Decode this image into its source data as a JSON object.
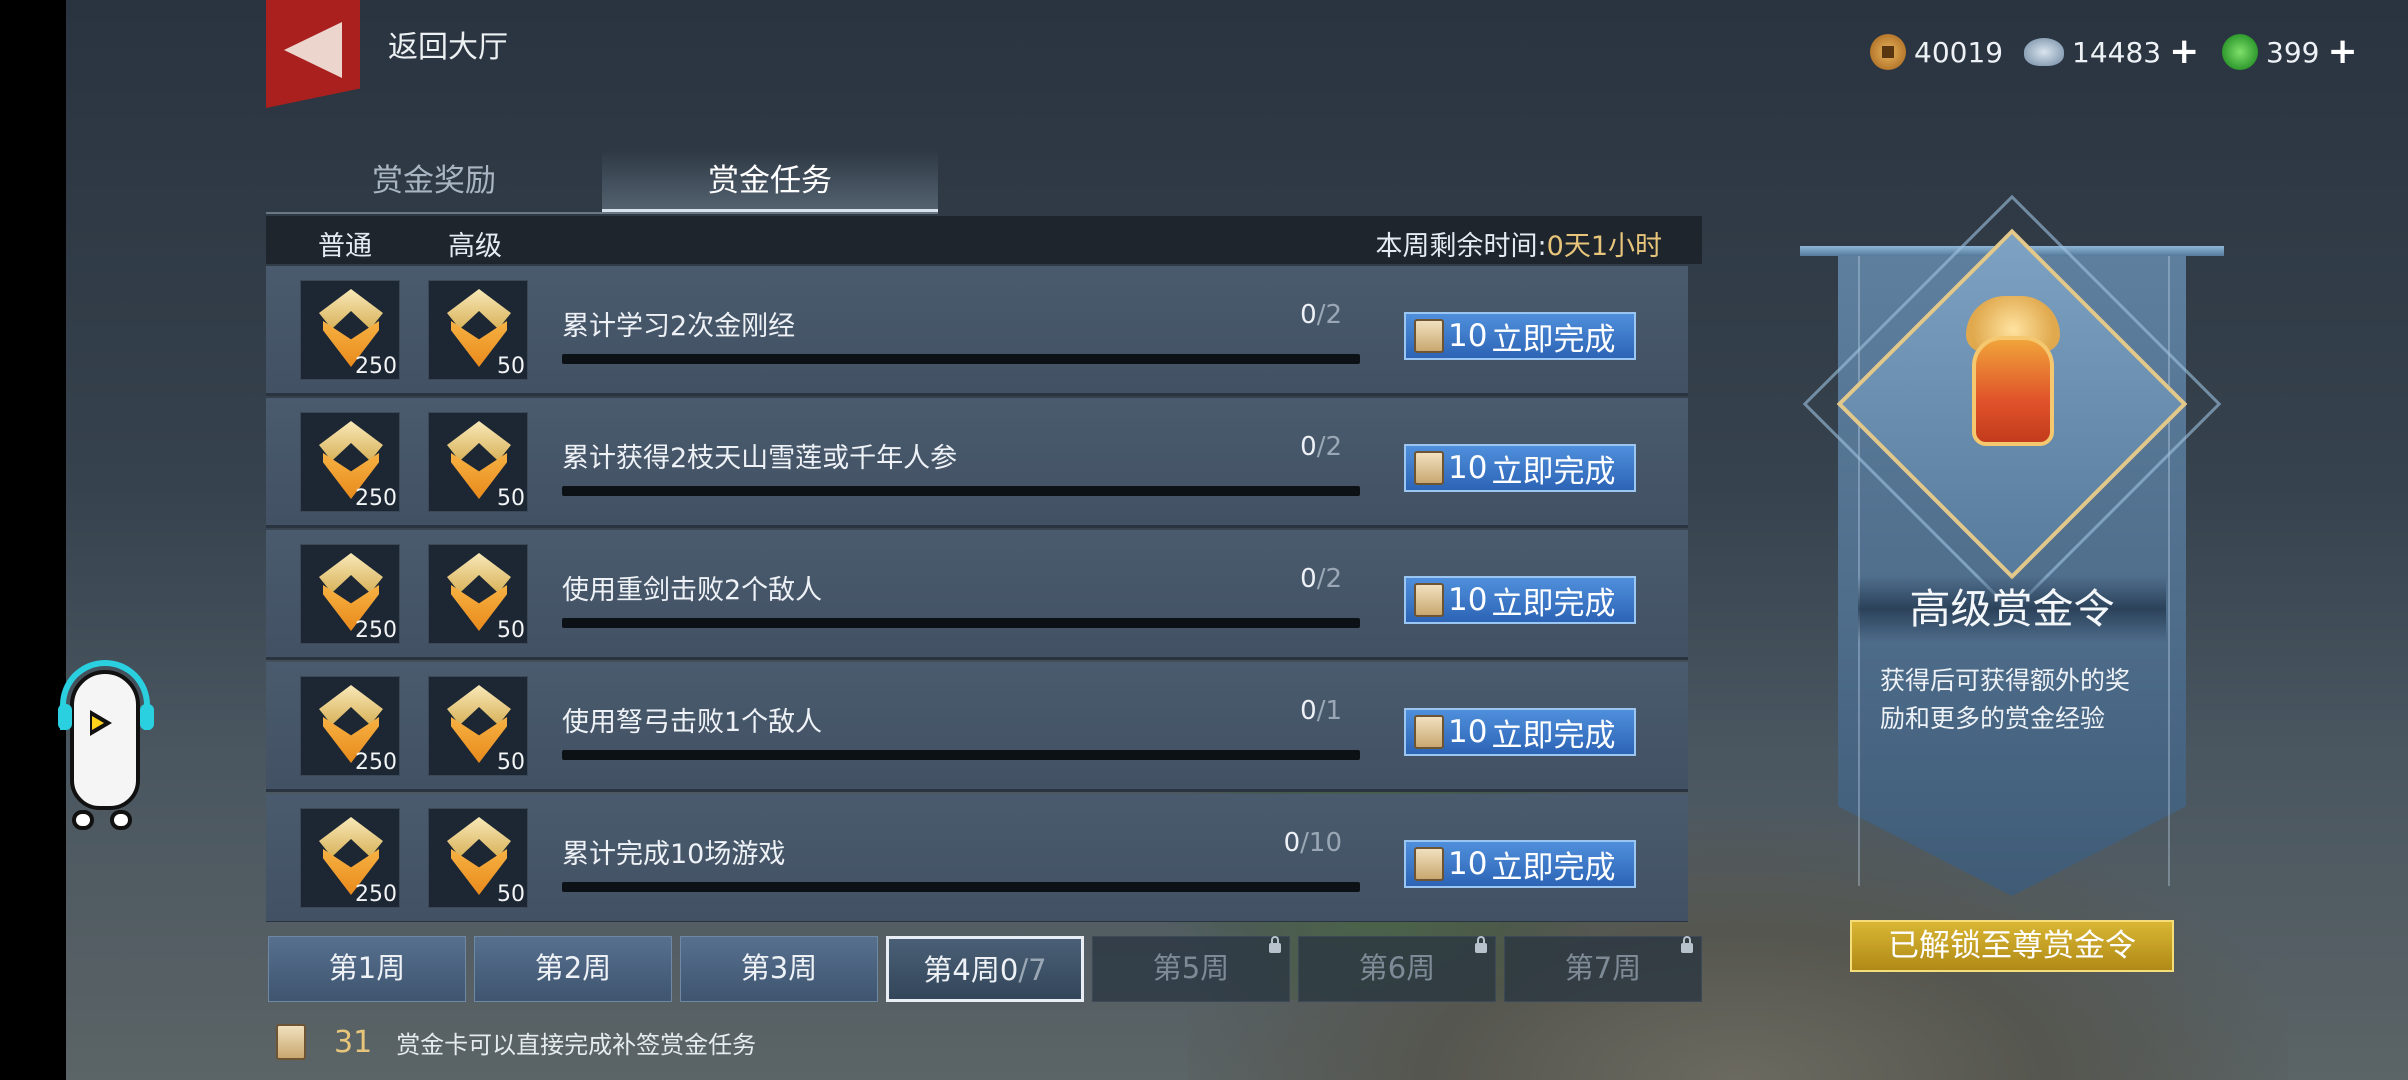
{
  "header": {
    "back_label": "返回大厅",
    "currencies": [
      {
        "name": "copper-coin",
        "amount": "40019",
        "has_add": false
      },
      {
        "name": "silver-ingot",
        "amount": "14483",
        "has_add": true
      },
      {
        "name": "jade",
        "amount": "399",
        "has_add": true
      }
    ],
    "add_symbol": "+"
  },
  "tabs": [
    {
      "label": "赏金奖励",
      "active": false
    },
    {
      "label": "赏金任务",
      "active": true
    }
  ],
  "table_header": {
    "col_normal": "普通",
    "col_advanced": "高级",
    "remain_label": "本周剩余时间:",
    "remain_value": "0天1小时"
  },
  "tasks": [
    {
      "name": "累计学习2次金刚经",
      "reward_normal": "250",
      "reward_advanced": "50",
      "progress": "0",
      "total": "/2",
      "button_cost": "10",
      "button_label": "立即完成"
    },
    {
      "name": "累计获得2枝天山雪莲或千年人参",
      "reward_normal": "250",
      "reward_advanced": "50",
      "progress": "0",
      "total": "/2",
      "button_cost": "10",
      "button_label": "立即完成"
    },
    {
      "name": "使用重剑击败2个敌人",
      "reward_normal": "250",
      "reward_advanced": "50",
      "progress": "0",
      "total": "/2",
      "button_cost": "10",
      "button_label": "立即完成"
    },
    {
      "name": "使用弩弓击败1个敌人",
      "reward_normal": "250",
      "reward_advanced": "50",
      "progress": "0",
      "total": "/1",
      "button_cost": "10",
      "button_label": "立即完成"
    },
    {
      "name": "累计完成10场游戏",
      "reward_normal": "250",
      "reward_advanced": "50",
      "progress": "0",
      "total": "/10",
      "button_cost": "10",
      "button_label": "立即完成"
    }
  ],
  "weeks": [
    {
      "label": "第1周",
      "state": "normal"
    },
    {
      "label": "第2周",
      "state": "normal"
    },
    {
      "label": "第3周",
      "state": "normal"
    },
    {
      "label": "第4周",
      "state": "active",
      "count": "0",
      "total": "/7"
    },
    {
      "label": "第5周",
      "state": "locked"
    },
    {
      "label": "第6周",
      "state": "locked"
    },
    {
      "label": "第7周",
      "state": "locked"
    }
  ],
  "bottom_note": {
    "card_count": "31",
    "text": "赏金卡可以直接完成补签赏金任务"
  },
  "banner": {
    "title": "高级赏金令",
    "description": "获得后可获得额外的奖励和更多的赏金经验",
    "unlock_button": "已解锁至尊赏金令"
  },
  "colors": {
    "accent_gold": "#e7c57a",
    "button_blue": "#2d64b5",
    "unlock_gold": "#c9a624"
  }
}
